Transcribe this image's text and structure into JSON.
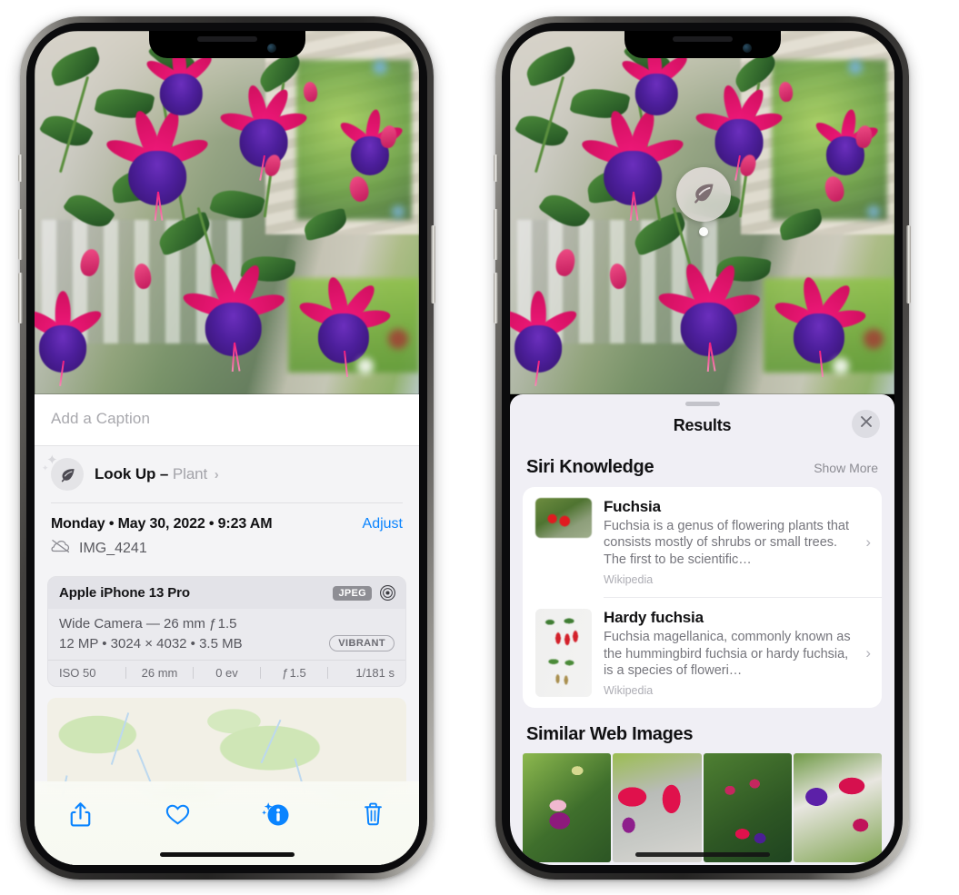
{
  "left_phone": {
    "caption_placeholder": "Add a Caption",
    "lookup": {
      "label": "Look Up",
      "dash": "–",
      "subject": "Plant",
      "chevron": "›",
      "icon": "leaf-icon"
    },
    "date": "Monday • May 30, 2022 • 9:23 AM",
    "adjust_label": "Adjust",
    "file_name": "IMG_4241",
    "cloud_icon": "icloud-slash-icon",
    "camera_card": {
      "device": "Apple iPhone 13 Pro",
      "format_badge": "JPEG",
      "aperture_icon": "aperture-icon",
      "lens_line": "Wide Camera — 26 mm ƒ 1.5",
      "specs_line": "12 MP • 3024 × 4032 • 3.5 MB",
      "style_badge": "VIBRANT",
      "exif": [
        "ISO 50",
        "26 mm",
        "0 ev",
        "ƒ 1.5",
        "1/181 s"
      ]
    },
    "toolbar": [
      {
        "name": "share-button",
        "icon": "share-icon"
      },
      {
        "name": "favorite-button",
        "icon": "heart-icon"
      },
      {
        "name": "info-button",
        "icon": "info-sparkle-icon"
      },
      {
        "name": "delete-button",
        "icon": "trash-icon"
      }
    ],
    "accent_color": "#0a84ff"
  },
  "right_phone": {
    "badge": {
      "icon": "leaf-icon",
      "name": "visual-lookup-badge"
    },
    "sheet": {
      "title": "Results",
      "close_icon": "close-icon",
      "siri_knowledge": {
        "heading": "Siri Knowledge",
        "show_more": "Show More",
        "items": [
          {
            "title": "Fuchsia",
            "description": "Fuchsia is a genus of flowering plants that consists mostly of shrubs or small trees. The first to be scientific…",
            "source": "Wikipedia"
          },
          {
            "title": "Hardy fuchsia",
            "description": "Fuchsia magellanica, commonly known as the hummingbird fuchsia or hardy fuchsia, is a species of floweri…",
            "source": "Wikipedia"
          }
        ]
      },
      "similar_web_images": {
        "heading": "Similar Web Images",
        "count": 4
      }
    }
  }
}
